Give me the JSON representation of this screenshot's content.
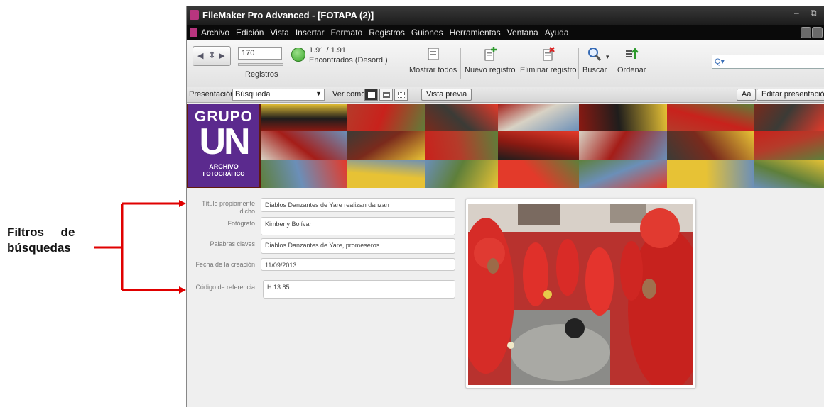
{
  "annotation": {
    "label_line1": "Filtros     de",
    "label_line2": "búsquedas",
    "arrow_color": "#e00000"
  },
  "window": {
    "title": "FileMaker Pro Advanced - [FOTAPA (2)]",
    "controls": "–  ⧉"
  },
  "menu": {
    "items": [
      "Archivo",
      "Edición",
      "Vista",
      "Insertar",
      "Formato",
      "Registros",
      "Guiones",
      "Herramientas",
      "Ventana",
      "Ayuda"
    ]
  },
  "toolbar": {
    "record_number": "170",
    "records_label": "Registros",
    "found_count": "1.91 / 1.91",
    "found_status": "Encontrados (Desord.)",
    "buttons": {
      "show_all": "Mostrar todos",
      "new_record": "Nuevo registro",
      "delete_record": "Eliminar registro",
      "search": "Buscar",
      "sort": "Ordenar"
    },
    "search_placeholder": ""
  },
  "layoutbar": {
    "layout_label": "Presentación:",
    "layout_value": "Búsqueda",
    "view_as_label": "Ver como:",
    "preview_button": "Vista previa",
    "aa_button": "Aa",
    "edit_layout_button": "Editar presentación"
  },
  "logo": {
    "line1": "GRUPO",
    "line2": "UN",
    "line3": "ARCHIVO",
    "line4": "FOTOGRÁFICO",
    "color": "#5b2a8e"
  },
  "fields": [
    {
      "label": "Título propiamente dicho",
      "value": "Diablos Danzantes de Yare realizan danzan"
    },
    {
      "label": "Fotógrafo",
      "value": "Kimberly Bolívar"
    },
    {
      "label": "Palabras claves",
      "value": "Diablos Danzantes de Yare, promeseros"
    },
    {
      "label": "Fecha de la creación",
      "value": "11/09/2013"
    },
    {
      "label": "Código de referencia",
      "value": "H.13.85"
    }
  ],
  "colors": {
    "menubar": "#0a0a0a",
    "banner_red": "#c8221c",
    "photo_red": "#d52a2a"
  }
}
